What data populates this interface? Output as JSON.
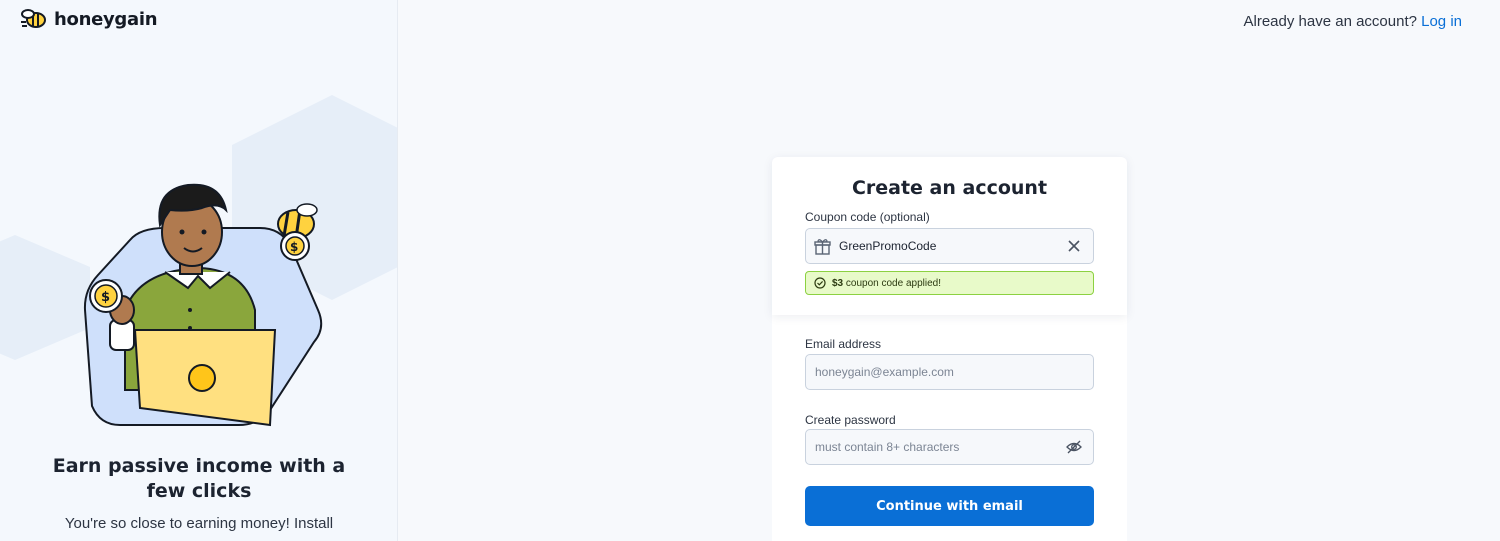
{
  "brand": {
    "name": "honeygain"
  },
  "left": {
    "headline": "Earn passive income with a few clicks",
    "subtext": "You're so close to earning money! Install"
  },
  "header": {
    "prompt": "Already have an account?",
    "login_label": "Log in"
  },
  "form": {
    "title": "Create an account",
    "coupon_label": "Coupon code (optional)",
    "coupon_value": "GreenPromoCode",
    "coupon_amount": "$3",
    "coupon_message": "coupon code applied!",
    "email_label": "Email address",
    "email_placeholder": "honeygain@example.com",
    "password_label": "Create password",
    "password_placeholder": "must contain 8+ characters",
    "submit_label": "Continue with email"
  },
  "colors": {
    "accent": "#0a6fd6",
    "success_bg": "#e8fac9",
    "success_border": "#8cd141",
    "panel_bg": "#f4f8fd"
  },
  "icons": [
    "bee-logo-icon",
    "gift-icon",
    "clear-icon",
    "check-circle-icon",
    "eye-off-icon"
  ]
}
